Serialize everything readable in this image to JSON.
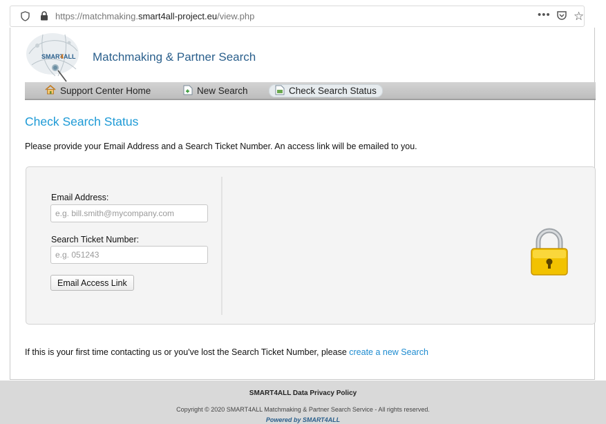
{
  "browser": {
    "url_prefix": "https://matchmaking.",
    "url_domain": "smart4all-project.eu",
    "url_path": "/view.php",
    "more_icon": "more-horizontal-icon",
    "pocket_icon": "pocket-icon",
    "bookmark_icon": "star-icon"
  },
  "header": {
    "title": "Matchmaking & Partner Search"
  },
  "nav": {
    "items": [
      {
        "label": "Support Center Home",
        "icon": "home-icon"
      },
      {
        "label": "New Search",
        "icon": "new-document-icon"
      },
      {
        "label": "Check Search Status",
        "icon": "document-status-icon",
        "active": true
      }
    ]
  },
  "main": {
    "heading": "Check Search Status",
    "intro": "Please provide your Email Address and a Search Ticket Number. An access link will be emailed to you.",
    "form": {
      "email_label": "Email Address:",
      "email_placeholder": "e.g. bill.smith@mycompany.com",
      "ticket_label": "Search Ticket Number:",
      "ticket_placeholder": "e.g. 051243",
      "submit_label": "Email Access Link"
    },
    "note_prefix": "If this is your first time contacting us or you've lost the Search Ticket Number, please ",
    "note_link": "create a new Search"
  },
  "footer": {
    "policy": "SMART4ALL Data Privacy Policy",
    "copyright": "Copyright © 2020 SMART4ALL Matchmaking & Partner Search Service - All rights reserved.",
    "powered": "Powered by SMART4ALL"
  },
  "colors": {
    "accent": "#1d9ad6",
    "brand": "#2a5f8c",
    "link": "#1d8bd0",
    "padlock": "#f2c200"
  }
}
